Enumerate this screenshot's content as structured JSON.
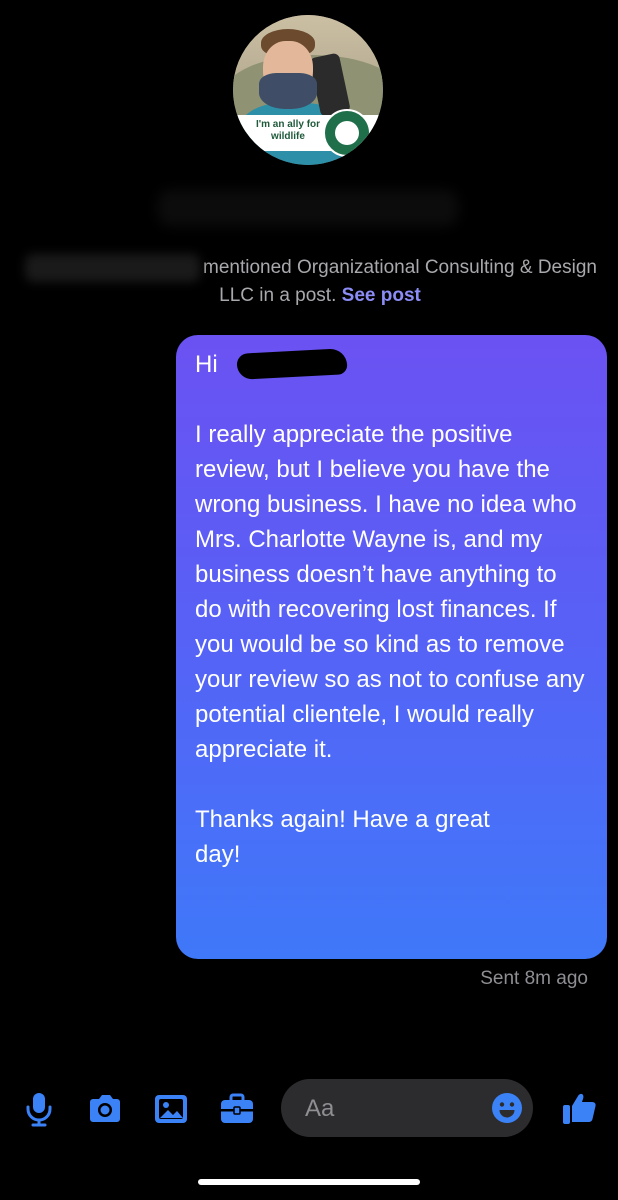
{
  "header": {
    "avatar_banner": "I'm an ally for wildlife",
    "subline": {
      "mentioned_text": "mentioned Organizational Consulting & Design LLC in a post.",
      "see_post_label": "See post"
    }
  },
  "message": {
    "greeting": "Hi",
    "greeting_end": "!",
    "paragraphs": [
      "I really appreciate the positive review, but I believe you have the wrong business. I have no idea who Mrs. Charlotte Wayne is, and my business doesn’t have anything to do with recovering lost finances. If you would be so kind as to remove your review so as not to confuse any potential clientele, I would really appreciate it.",
      "Thanks again! Have a great day!"
    ],
    "status": "Sent 8m ago"
  },
  "composer": {
    "placeholder": "Aa"
  },
  "icons": {
    "accent_color": "#3b82f6",
    "toolbar": [
      "microphone-icon",
      "camera-icon",
      "image-icon",
      "briefcase-icon"
    ],
    "send": "thumbs-up-icon",
    "emoji": "emoji-icon"
  }
}
